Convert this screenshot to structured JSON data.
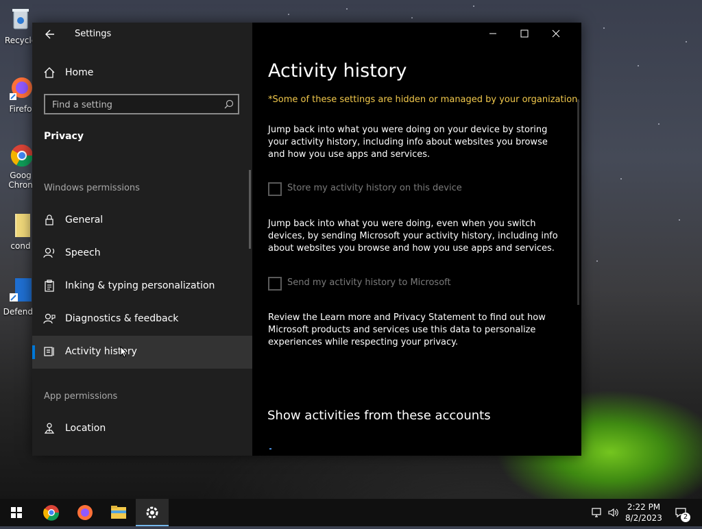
{
  "desktop": {
    "icons": [
      {
        "label": "Recycle"
      },
      {
        "label": "Firefo"
      },
      {
        "label": "Goog Chron"
      },
      {
        "label": "cond"
      },
      {
        "label": "Defende"
      }
    ]
  },
  "window": {
    "app_title": "Settings",
    "nav": {
      "home_label": "Home",
      "search_placeholder": "Find a setting",
      "section_title": "Privacy",
      "windows_permissions_header": "Windows permissions",
      "items": [
        {
          "label": "General",
          "icon": "lock-icon"
        },
        {
          "label": "Speech",
          "icon": "speech-icon"
        },
        {
          "label": "Inking & typing personalization",
          "icon": "clipboard-icon"
        },
        {
          "label": "Diagnostics & feedback",
          "icon": "feedback-icon"
        },
        {
          "label": "Activity history",
          "icon": "activity-history-icon",
          "selected": true
        }
      ],
      "app_permissions_header": "App permissions",
      "app_items": [
        {
          "label": "Location",
          "icon": "location-icon"
        }
      ]
    },
    "content": {
      "title": "Activity history",
      "managed_warning": "*Some of these settings are hidden or managed by your organization.",
      "para1": "Jump back into what you were doing on your device by storing your activity history, including info about websites you browse and how you use apps and services.",
      "checkbox1": {
        "label": "Store my activity history on this device",
        "checked": false,
        "disabled": true
      },
      "para2": "Jump back into what you were doing, even when you switch devices, by sending Microsoft your activity history, including info about websites you browse and how you use apps and services.",
      "checkbox2": {
        "label": "Send my activity history to Microsoft",
        "checked": false,
        "disabled": true
      },
      "para3": "Review the Learn more and Privacy Statement to find out how Microsoft products and services use this data to personalize experiences while respecting your privacy.",
      "accounts_heading": "Show activities from these accounts"
    }
  },
  "taskbar": {
    "time": "2:22 PM",
    "date": "8/2/2023",
    "notification_count": "2",
    "colors": {
      "accent": "#0078d7",
      "active_underline": "#76b9ed",
      "warning": "#f2c94c"
    }
  }
}
